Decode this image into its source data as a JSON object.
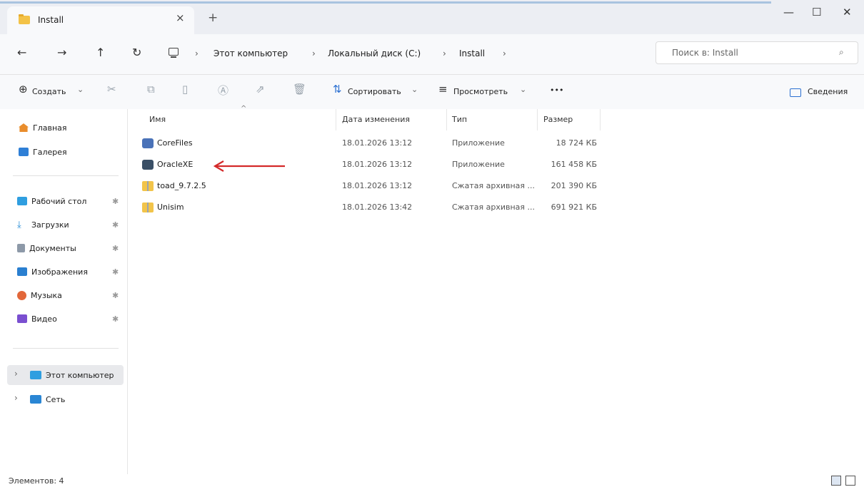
{
  "window": {
    "tab_title": "Install",
    "tab_close": "×",
    "new_tab": "+",
    "minimize": "—",
    "maximize": "☐",
    "close": "✕"
  },
  "address": {
    "back": "←",
    "forward": "→",
    "up": "↑",
    "refresh": "↻",
    "breadcrumb": [
      "Этот компьютер",
      "Локальный диск (C:)",
      "Install"
    ],
    "separator": "›",
    "search_placeholder": "Поиск в: Install",
    "search_icon": "⌕"
  },
  "toolbar": {
    "create_icon": "⊕",
    "create": "Создать",
    "create_chevron": "⌄",
    "sort_icon": "⇅",
    "sort": "Сортировать",
    "sort_chevron": "⌄",
    "view_icon": "≡",
    "view": "Просмотреть",
    "view_chevron": "⌄",
    "more": "•••",
    "details": "Сведения"
  },
  "sidebar": {
    "home": "Главная",
    "gallery": "Галерея",
    "pinned": [
      {
        "label": "Рабочий стол",
        "icon": "desktop-icon",
        "color": "#2f9ee0"
      },
      {
        "label": "Загрузки",
        "icon": "download-icon",
        "color": "#1e88d6"
      },
      {
        "label": "Документы",
        "icon": "documents-icon",
        "color": "#8d99a8"
      },
      {
        "label": "Изображения",
        "icon": "pictures-icon",
        "color": "#2a7fd0"
      },
      {
        "label": "Музыка",
        "icon": "music-icon",
        "color": "#e2673a"
      },
      {
        "label": "Видео",
        "icon": "video-icon",
        "color": "#7a4fd0"
      }
    ],
    "pin_glyph": "✱",
    "this_pc": "Этот компьютер",
    "network": "Сеть",
    "caret": "›"
  },
  "columns": {
    "name": "Имя",
    "date": "Дата изменения",
    "type": "Тип",
    "size": "Размер",
    "sort_indicator": "^"
  },
  "files": [
    {
      "name": "CoreFiles",
      "date": "18.01.2026 13:12",
      "type": "Приложение",
      "size": "18 724 КБ",
      "icon": "installer-icon"
    },
    {
      "name": "OracleXE",
      "date": "18.01.2026 13:12",
      "type": "Приложение",
      "size": "161 458 КБ",
      "icon": "installer-icon"
    },
    {
      "name": "toad_9.7.2.5",
      "date": "18.01.2026 13:12",
      "type": "Сжатая архивная ...",
      "size": "201 390 КБ",
      "icon": "zip-folder-icon"
    },
    {
      "name": "Unisim",
      "date": "18.01.2026 13:42",
      "type": "Сжатая архивная ...",
      "size": "691 921 КБ",
      "icon": "zip-folder-icon"
    }
  ],
  "status": {
    "count": "Элементов: 4"
  },
  "annotation": {
    "color": "#d42a2a"
  }
}
